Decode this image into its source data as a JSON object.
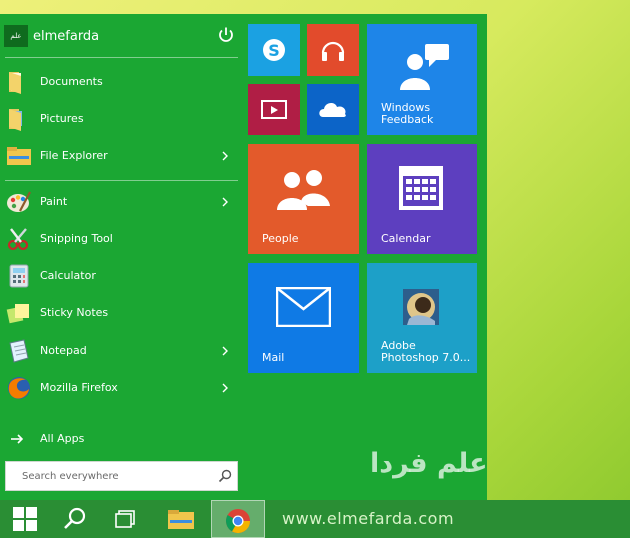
{
  "user": {
    "name": "elmefarda",
    "badge_text": "علم فردا"
  },
  "menu": {
    "items": [
      {
        "label": "Documents",
        "icon": "documents-folder-icon",
        "submenu": false
      },
      {
        "label": "Pictures",
        "icon": "pictures-folder-icon",
        "submenu": false
      },
      {
        "label": "File Explorer",
        "icon": "file-explorer-icon",
        "submenu": true
      },
      {
        "label": "Paint",
        "icon": "paint-icon",
        "submenu": true
      },
      {
        "label": "Snipping Tool",
        "icon": "snipping-tool-icon",
        "submenu": false
      },
      {
        "label": "Calculator",
        "icon": "calculator-icon",
        "submenu": false
      },
      {
        "label": "Sticky Notes",
        "icon": "sticky-notes-icon",
        "submenu": false
      },
      {
        "label": "Notepad",
        "icon": "notepad-icon",
        "submenu": true
      },
      {
        "label": "Mozilla Firefox",
        "icon": "firefox-icon",
        "submenu": true
      }
    ],
    "all_apps_label": "All Apps",
    "search_placeholder": "Search everywhere"
  },
  "tiles": [
    {
      "label": "",
      "icon": "skype-icon",
      "color": "#1ba1e2"
    },
    {
      "label": "",
      "icon": "music-headphones-icon",
      "color": "#e24b2c"
    },
    {
      "label": "Windows Feedback",
      "icon": "feedback-icon",
      "color": "#1e85e8"
    },
    {
      "label": "",
      "icon": "video-icon",
      "color": "#b01e45"
    },
    {
      "label": "",
      "icon": "onedrive-icon",
      "color": "#0c64c8"
    },
    {
      "label": "People",
      "icon": "people-icon",
      "color": "#e35a2b"
    },
    {
      "label": "Calendar",
      "icon": "calendar-icon",
      "color": "#5d3fbf"
    },
    {
      "label": "Mail",
      "icon": "mail-icon",
      "color": "#0f7ae5"
    },
    {
      "label": "Adobe Photoshop 7.0...",
      "icon": "photoshop-icon",
      "color": "#1da0c8"
    }
  ],
  "watermark": "علم فردا",
  "taskbar": {
    "url_text": "www.elmefarda.com",
    "buttons": [
      "start-windows-icon",
      "search-icon",
      "task-view-icon",
      "file-explorer-icon",
      "chrome-icon"
    ]
  },
  "colors": {
    "start_menu_bg": "#1ba733",
    "taskbar_bg": "#2a8e34",
    "desktop_bg": "#d7ea5e"
  }
}
